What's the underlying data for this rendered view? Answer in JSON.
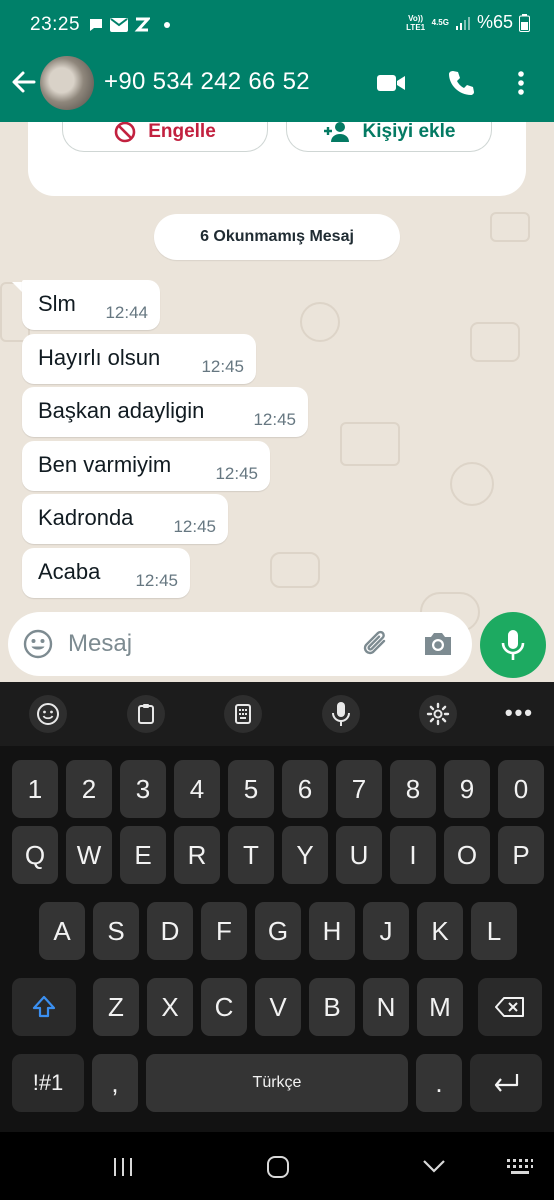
{
  "status_bar": {
    "time": "23:25",
    "volte_label": "Vo)) LTE1",
    "network_label": "4.5G",
    "battery": "%65"
  },
  "header": {
    "contact_name": "+90 534 242 66 52",
    "bg_color": "#008069"
  },
  "actions": {
    "block_label": "Engelle",
    "add_contact_label": "Kişiyi ekle"
  },
  "unread_banner": "6 Okunmamış Mesaj",
  "messages": [
    {
      "text": "Slm",
      "time": "12:44"
    },
    {
      "text": "Hayırlı olsun",
      "time": "12:45"
    },
    {
      "text": "Başkan adayligin",
      "time": "12:45"
    },
    {
      "text": "Ben varmiyim",
      "time": "12:45"
    },
    {
      "text": "Kadronda",
      "time": "12:45"
    },
    {
      "text": "Acaba",
      "time": "12:45"
    }
  ],
  "composer": {
    "placeholder": "Mesaj"
  },
  "keyboard": {
    "number_row": [
      "1",
      "2",
      "3",
      "4",
      "5",
      "6",
      "7",
      "8",
      "9",
      "0"
    ],
    "row1": [
      "Q",
      "W",
      "E",
      "R",
      "T",
      "Y",
      "U",
      "I",
      "O",
      "P"
    ],
    "row2": [
      "A",
      "S",
      "D",
      "F",
      "G",
      "H",
      "J",
      "K",
      "L"
    ],
    "row3": [
      "Z",
      "X",
      "C",
      "V",
      "B",
      "N",
      "M"
    ],
    "symbols_label": "!#1",
    "comma_label": ",",
    "space_label": "Türkçe",
    "period_label": "."
  },
  "icons": [
    "back-arrow-icon",
    "video-call-icon",
    "phone-icon",
    "more-vert-icon",
    "block-icon",
    "add-person-icon",
    "emoji-icon",
    "attach-icon",
    "camera-icon",
    "mic-icon",
    "clipboard-icon",
    "keypad-icon",
    "settings-icon",
    "shift-icon",
    "backspace-icon",
    "enter-icon",
    "recents-icon",
    "home-icon",
    "nav-back-icon",
    "keyboard-icon"
  ]
}
